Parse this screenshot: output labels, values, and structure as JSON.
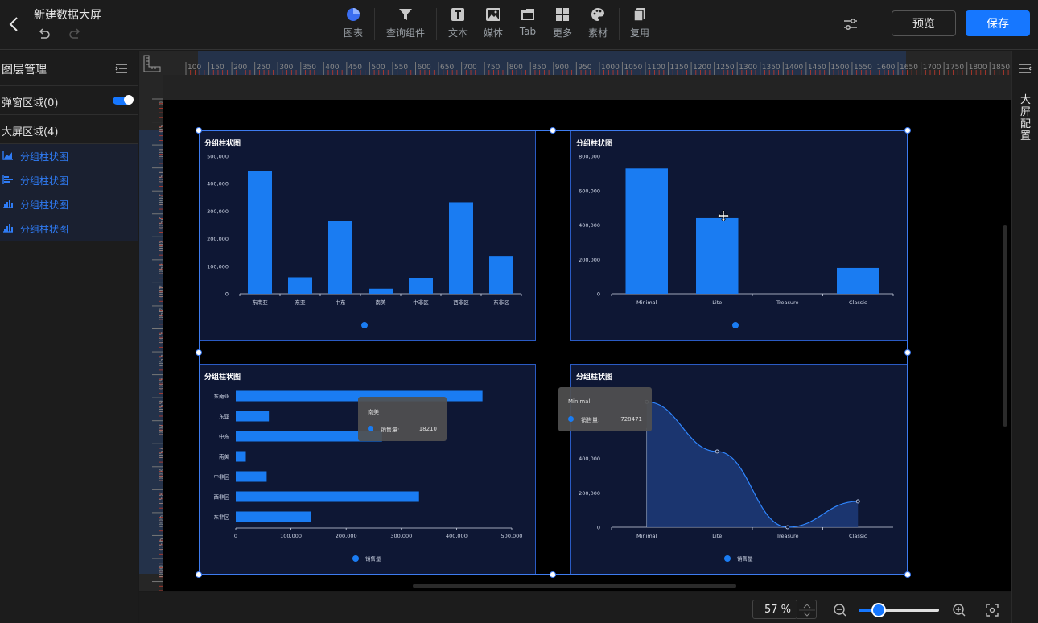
{
  "app": {
    "title": "新建数据大屏"
  },
  "toolbar": {
    "items": [
      {
        "label": "图表",
        "icon": "pie-chart-icon"
      },
      {
        "label": "查询组件",
        "icon": "filter-icon"
      },
      {
        "label": "文本",
        "icon": "text-icon"
      },
      {
        "label": "媒体",
        "icon": "image-icon"
      },
      {
        "label": "Tab",
        "icon": "tab-icon"
      },
      {
        "label": "更多",
        "icon": "grid-icon"
      },
      {
        "label": "素材",
        "icon": "palette-icon"
      },
      {
        "label": "复用",
        "icon": "copy-icon"
      }
    ],
    "preview_label": "预览",
    "save_label": "保存"
  },
  "colors": {
    "accent": "#1677ff",
    "bar": "#1a7cf2",
    "card_bg": "#0e1734",
    "canvas_bg": "#000000"
  },
  "left_panel": {
    "title": "图层管理",
    "popup_area": "弹窗区域(0)",
    "popup_toggle_on": true,
    "screen_area": "大屏区域(4)",
    "layers": [
      {
        "label": "分组柱状图",
        "icon": "area-chart-icon"
      },
      {
        "label": "分组柱状图",
        "icon": "horizontal-bar-icon"
      },
      {
        "label": "分组柱状图",
        "icon": "bar-chart-icon"
      },
      {
        "label": "分组柱状图",
        "icon": "bar-chart-icon"
      }
    ]
  },
  "right_panel": {
    "label": "大屏配置"
  },
  "rulers": {
    "h_labels": [
      "100",
      "150",
      "200",
      "250",
      "300",
      "350",
      "400",
      "450",
      "500",
      "550",
      "600",
      "650",
      "700",
      "750",
      "800",
      "850",
      "900",
      "950",
      "1000",
      "1050",
      "1100",
      "1150",
      "1200",
      "1250",
      "1300",
      "1350",
      "1400",
      "1450",
      "1500",
      "1550",
      "1600",
      "1650",
      "1700",
      "1750",
      "1800",
      "1850"
    ],
    "v_labels": [
      "0",
      "50",
      "100",
      "150",
      "200",
      "250",
      "300",
      "350",
      "400",
      "450",
      "500",
      "550",
      "600",
      "650",
      "700",
      "750",
      "800",
      "850",
      "900",
      "950",
      "1000"
    ]
  },
  "zoom": {
    "value": "57 %",
    "level": 0.25
  },
  "chart_data": [
    {
      "type": "bar",
      "title": "分组柱状图",
      "categories": [
        "东南亚",
        "东亚",
        "中东",
        "南美",
        "中非区",
        "西非区",
        "东非区"
      ],
      "values": [
        447000,
        60000,
        265000,
        18210,
        56000,
        332000,
        137000
      ],
      "y_ticks": [
        "0",
        "100,000",
        "200,000",
        "300,000",
        "400,000",
        "500,000"
      ],
      "ylim": [
        0,
        500000
      ]
    },
    {
      "type": "bar",
      "title": "分组柱状图",
      "categories": [
        "Minimal",
        "Lite",
        "Treasure",
        "Classic"
      ],
      "values": [
        728471,
        440000,
        0,
        150000
      ],
      "y_ticks": [
        "0",
        "200,000",
        "400,000",
        "600,000",
        "800,000"
      ],
      "ylim": [
        0,
        800000
      ]
    },
    {
      "type": "bar",
      "orientation": "horizontal",
      "title": "分组柱状图",
      "categories": [
        "东南亚",
        "东亚",
        "中东",
        "南美",
        "中非区",
        "西非区",
        "东非区"
      ],
      "values": [
        447000,
        60000,
        265000,
        18210,
        56000,
        332000,
        137000
      ],
      "x_ticks": [
        "0",
        "100,000",
        "200,000",
        "300,000",
        "400,000",
        "500,000"
      ],
      "xlim": [
        0,
        500000
      ],
      "legend": "销售量",
      "tooltip": {
        "title": "南美",
        "series": "销售量:",
        "value": "18210"
      }
    },
    {
      "type": "area",
      "title": "分组柱状图",
      "categories": [
        "Minimal",
        "Lite",
        "Treasure",
        "Classic"
      ],
      "values": [
        728471,
        440000,
        0,
        150000
      ],
      "y_ticks": [
        "0",
        "200,000",
        "400,000"
      ],
      "ylim": [
        0,
        800000
      ],
      "legend": "销售量",
      "tooltip": {
        "title": "Minimal",
        "series": "销售量:",
        "value": "728471"
      }
    }
  ]
}
